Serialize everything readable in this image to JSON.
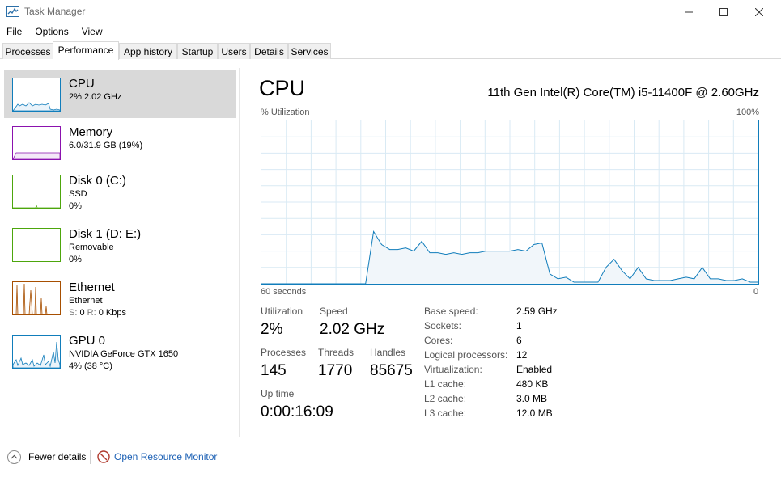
{
  "window": {
    "title": "Task Manager"
  },
  "menu": [
    "File",
    "Options",
    "View"
  ],
  "tabs": [
    {
      "label": "Processes",
      "active": false
    },
    {
      "label": "Performance",
      "active": true
    },
    {
      "label": "App history",
      "active": false
    },
    {
      "label": "Startup",
      "active": false
    },
    {
      "label": "Users",
      "active": false
    },
    {
      "label": "Details",
      "active": false
    },
    {
      "label": "Services",
      "active": false
    }
  ],
  "resources": [
    {
      "name": "CPU",
      "line1": "2% 2.02 GHz",
      "line2": "",
      "color": "#117dbb",
      "selected": true
    },
    {
      "name": "Memory",
      "line1": "6.0/31.9 GB (19%)",
      "line2": "",
      "color": "#8b12ae",
      "selected": false
    },
    {
      "name": "Disk 0 (C:)",
      "line1": "SSD",
      "line2": "0%",
      "color": "#4da60c",
      "selected": false
    },
    {
      "name": "Disk 1 (D: E:)",
      "line1": "Removable",
      "line2": "0%",
      "color": "#4da60c",
      "selected": false
    },
    {
      "name": "Ethernet",
      "line1": "Ethernet",
      "line2_muted_s": "S:",
      "line2_s": "0",
      "line2_muted_r": "R:",
      "line2_r": "0 Kbps",
      "color": "#a74f01",
      "selected": false
    },
    {
      "name": "GPU 0",
      "line1": "NVIDIA GeForce GTX 1650",
      "line2": "4% (38 °C)",
      "color": "#117dbb",
      "selected": false
    }
  ],
  "main": {
    "title": "CPU",
    "model": "11th Gen Intel(R) Core(TM) i5-11400F @ 2.60GHz",
    "y_label": "% Utilization",
    "y_max_label": "100%",
    "x_left_label": "60 seconds",
    "x_right_label": "0",
    "graph_color": "#117dbb",
    "utilization_history": [
      0,
      0,
      0,
      0,
      0,
      0,
      0,
      0,
      0,
      0,
      0,
      0,
      0,
      0,
      32,
      24,
      21,
      21,
      22,
      20,
      26,
      19,
      19,
      18,
      19,
      18,
      19,
      19,
      20,
      20,
      20,
      20,
      21,
      20,
      24,
      25,
      6,
      3,
      4,
      1,
      1,
      1,
      1,
      10,
      15,
      8,
      3,
      10,
      3,
      2,
      2,
      2,
      3,
      4,
      3,
      10,
      3,
      3,
      2,
      2,
      3,
      1,
      1
    ]
  },
  "stats": {
    "utilization_label": "Utilization",
    "utilization_value": "2%",
    "speed_label": "Speed",
    "speed_value": "2.02 GHz",
    "processes_label": "Processes",
    "processes_value": "145",
    "threads_label": "Threads",
    "threads_value": "1770",
    "handles_label": "Handles",
    "handles_value": "85675",
    "uptime_label": "Up time",
    "uptime_value": "0:00:16:09"
  },
  "details": [
    {
      "label": "Base speed:",
      "value": "2.59 GHz"
    },
    {
      "label": "Sockets:",
      "value": "1"
    },
    {
      "label": "Cores:",
      "value": "6"
    },
    {
      "label": "Logical processors:",
      "value": "12"
    },
    {
      "label": "Virtualization:",
      "value": "Enabled"
    },
    {
      "label": "L1 cache:",
      "value": "480 KB"
    },
    {
      "label": "L2 cache:",
      "value": "3.0 MB"
    },
    {
      "label": "L3 cache:",
      "value": "12.0 MB"
    }
  ],
  "footer": {
    "fewer_details": "Fewer details",
    "resource_monitor": "Open Resource Monitor"
  }
}
